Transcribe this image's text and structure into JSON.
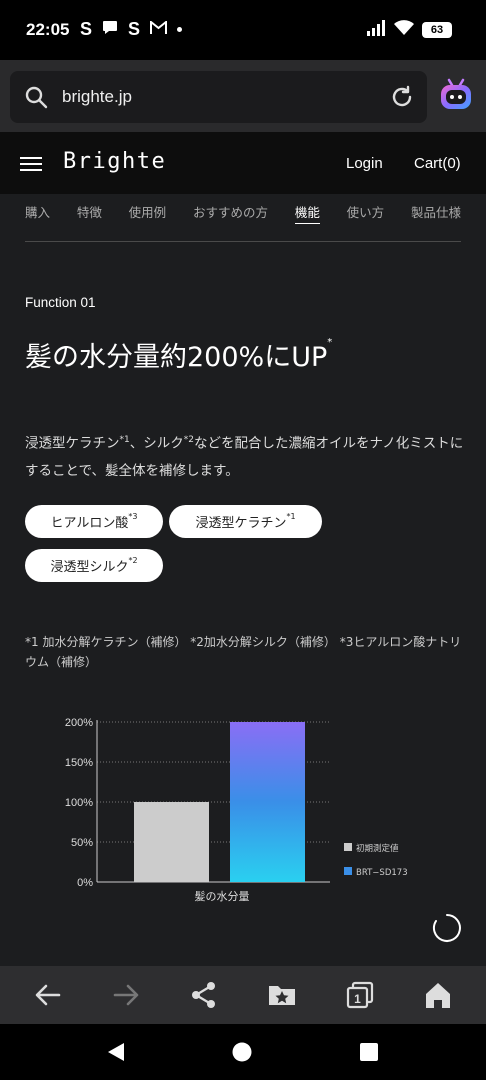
{
  "status": {
    "time": "22:05",
    "notification_icons": [
      "S",
      "chat-icon",
      "S",
      "M"
    ],
    "battery": "63"
  },
  "browser": {
    "url": "brighte.jp"
  },
  "site": {
    "brand": "Brighte",
    "login": "Login",
    "cart": "Cart(0)"
  },
  "tabs": [
    {
      "label": "購入",
      "active": false
    },
    {
      "label": "特徴",
      "active": false
    },
    {
      "label": "使用例",
      "active": false
    },
    {
      "label": "おすすめの方",
      "active": false
    },
    {
      "label": "機能",
      "active": true
    },
    {
      "label": "使い方",
      "active": false
    },
    {
      "label": "製品仕様",
      "active": false
    }
  ],
  "function": {
    "label": "Function 01",
    "headline": "髪の水分量約200%にUP",
    "headline_sup": "*",
    "desc_part1": "浸透型ケラチン",
    "desc_sup1": "*1",
    "desc_part2": "、シルク",
    "desc_sup2": "*2",
    "desc_part3": "などを配合した濃縮オイルをナノ化ミストにすることで、髪全体を補修します。",
    "pills": [
      {
        "label": "ヒアルロン酸",
        "sup": "*3"
      },
      {
        "label": "浸透型ケラチン",
        "sup": "*1"
      },
      {
        "label": "浸透型シルク",
        "sup": "*2"
      }
    ],
    "footnote": "*1 加水分解ケラチン（補修） *2加水分解シルク（補修） *3ヒアルロン酸ナトリウム（補修）"
  },
  "chart_data": {
    "type": "bar",
    "categories": [
      "髪の水分量"
    ],
    "series": [
      {
        "name": "初期測定値",
        "values": [
          100
        ],
        "color": "#cccccc"
      },
      {
        "name": "BRT−SD173",
        "values": [
          200
        ],
        "color": "#3a8fe8"
      }
    ],
    "yticks": [
      "0%",
      "50%",
      "100%",
      "150%",
      "200%"
    ],
    "ylim": [
      0,
      200
    ],
    "xlabel": "髪の水分量",
    "legend_position": "right"
  },
  "colors": {
    "background": "#1c1d1f",
    "gradient_top": "#8a6ef5",
    "gradient_bottom": "#2ad0f0"
  }
}
